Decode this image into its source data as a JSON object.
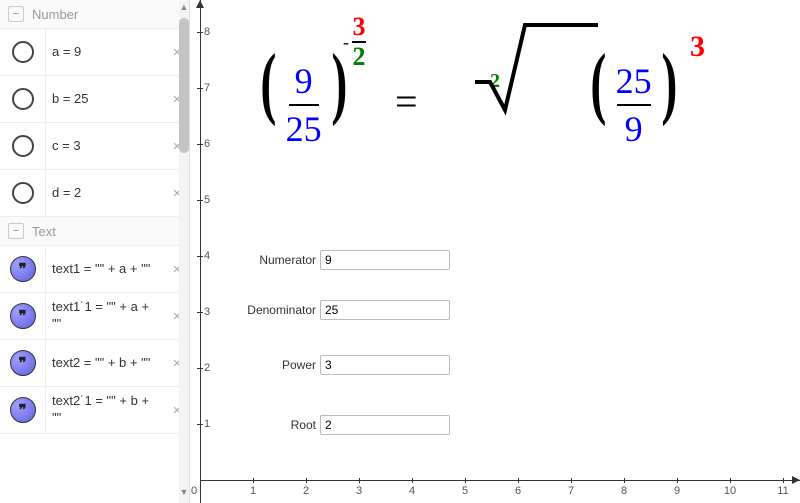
{
  "sidebar": {
    "groups": [
      {
        "title": "Number",
        "rows": [
          {
            "marker": "empty",
            "text": "a = 9"
          },
          {
            "marker": "empty",
            "text": "b = 25"
          },
          {
            "marker": "empty",
            "text": "c = 3"
          },
          {
            "marker": "empty",
            "text": "d = 2"
          }
        ]
      },
      {
        "title": "Text",
        "rows": [
          {
            "marker": "text",
            "text": "text1 = \"\" + a + \"\""
          },
          {
            "marker": "text",
            "text": "text1˙1 = \"\" + a + \"\""
          },
          {
            "marker": "text",
            "text": "text2 = \"\" + b + \"\""
          },
          {
            "marker": "text",
            "text": "text2˙1 = \"\" + b + \"\""
          }
        ]
      }
    ]
  },
  "equation": {
    "left": {
      "num": "9",
      "den": "25"
    },
    "exp_neg": "-",
    "exp_num": "3",
    "exp_den": "2",
    "equals": "=",
    "root_index": "2",
    "right": {
      "num": "25",
      "den": "9"
    },
    "right_exp": "3"
  },
  "fields": [
    {
      "label": "Numerator",
      "value": "9"
    },
    {
      "label": "Denominator",
      "value": "25"
    },
    {
      "label": "Power",
      "value": "3"
    },
    {
      "label": "Root",
      "value": "2"
    }
  ],
  "icons": {
    "collapse": "−",
    "close": "×",
    "quote": "❞"
  },
  "axis": {
    "x_ticks": [
      "0",
      "1",
      "2",
      "3",
      "4",
      "5",
      "6",
      "7",
      "8",
      "9",
      "10",
      "11"
    ],
    "y_ticks": [
      "1",
      "2",
      "3",
      "4",
      "5",
      "6",
      "7",
      "8"
    ]
  }
}
